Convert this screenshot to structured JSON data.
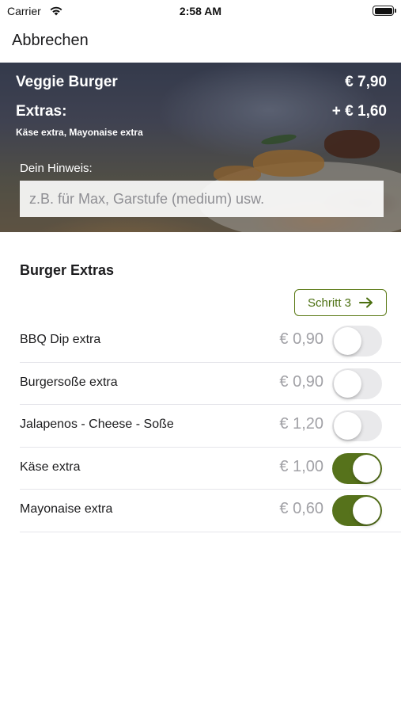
{
  "status_bar": {
    "carrier": "Carrier",
    "time": "2:58 AM",
    "wifi_icon": "wifi-icon",
    "battery_icon": "battery-icon"
  },
  "nav": {
    "cancel_label": "Abbrechen"
  },
  "summary": {
    "product_name": "Veggie Burger",
    "product_price": "€ 7,90",
    "extras_label": "Extras:",
    "extras_price": "+ € 1,60",
    "extras_list": "Käse extra, Mayonaise extra",
    "note_label": "Dein Hinweis:",
    "note_value": "",
    "note_placeholder": "z.B. für Max, Garstufe (medium) usw."
  },
  "section": {
    "title": "Burger Extras",
    "step_button_label": "Schritt 3",
    "step_icon": "arrow-right-icon"
  },
  "extras": [
    {
      "label": "BBQ Dip extra",
      "price": "€ 0,90",
      "selected": false
    },
    {
      "label": "Burgersoße extra",
      "price": "€ 0,90",
      "selected": false
    },
    {
      "label": "Jalapenos - Cheese - Soße",
      "price": "€ 1,20",
      "selected": false
    },
    {
      "label": "Käse extra",
      "price": "€ 1,00",
      "selected": true
    },
    {
      "label": "Mayonaise extra",
      "price": "€ 0,60",
      "selected": true
    }
  ],
  "colors": {
    "accent": "#56721b",
    "toggle_off": "#e9e9eb",
    "price_gray": "#a1a1a6"
  }
}
